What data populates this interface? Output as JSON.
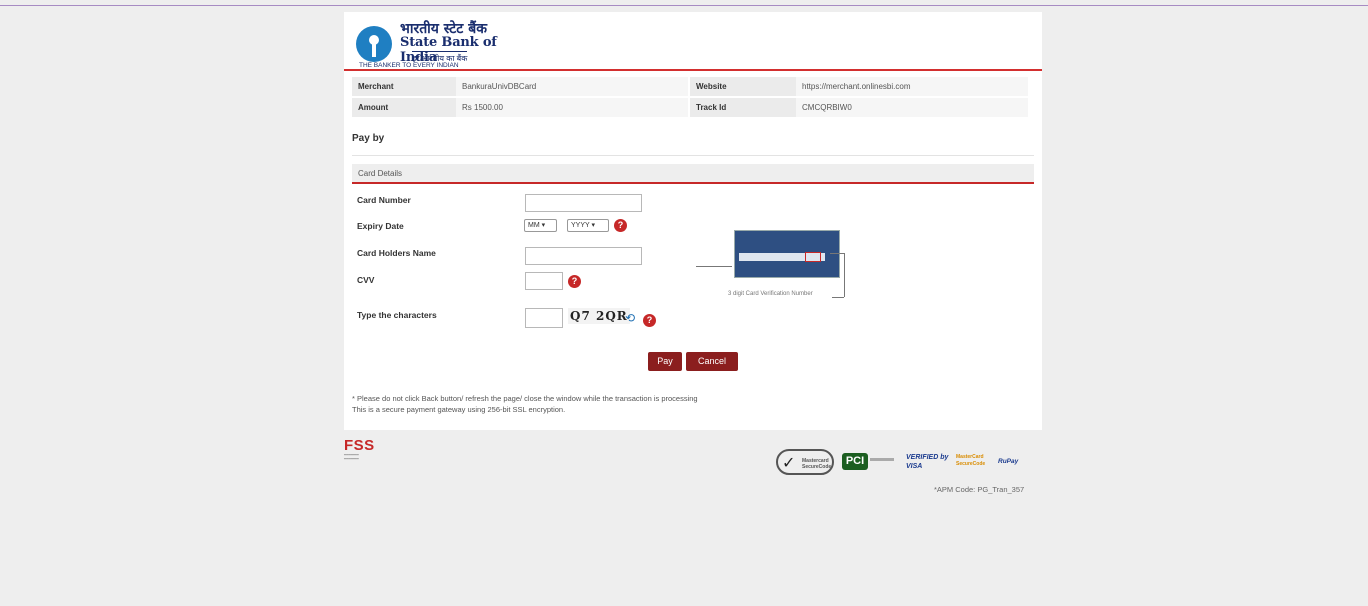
{
  "bank": {
    "name_hindi": "भारतीय स्टेट बैंक",
    "name": "State Bank of India",
    "tagline_hindi": "हर भारतीय का बैंक",
    "tagline": "THE BANKER TO EVERY INDIAN"
  },
  "info": {
    "merchant_label": "Merchant",
    "merchant_value": "BankuraUnivDBCard",
    "website_label": "Website",
    "website_value": "https://merchant.onlinesbi.com",
    "amount_label": "Amount",
    "amount_value": "Rs 1500.00",
    "trackid_label": "Track Id",
    "trackid_value": "CMCQRBIW0"
  },
  "payby": "Pay by",
  "section_title": "Card Details",
  "form": {
    "card_number_label": "Card Number",
    "expiry_label": "Expiry Date",
    "expiry_month": "MM",
    "expiry_year": "YYYY",
    "holder_label": "Card Holders Name",
    "cvv_label": "CVV",
    "captcha_label": "Type the characters",
    "captcha_text": "Q7 2QR"
  },
  "cvv_caption": "3 digit Card Verification Number",
  "buttons": {
    "pay": "Pay",
    "cancel": "Cancel"
  },
  "notes": {
    "line1": "* Please do not click Back button/ refresh the page/ close the window while the transaction is processing",
    "line2": "This is a secure payment gateway using 256-bit SSL encryption."
  },
  "footer": {
    "fss": "FSS",
    "badges": [
      "Mastercard SecureCode",
      "PCI",
      "VERIFIED by VISA",
      "MasterCard SecureCode",
      "RuPay"
    ],
    "apm_code": "*APM Code: PG_Tran_357"
  },
  "colors": {
    "accent": "#c62828",
    "button": "#8b1e1e",
    "brand": "#1f7fc2"
  }
}
